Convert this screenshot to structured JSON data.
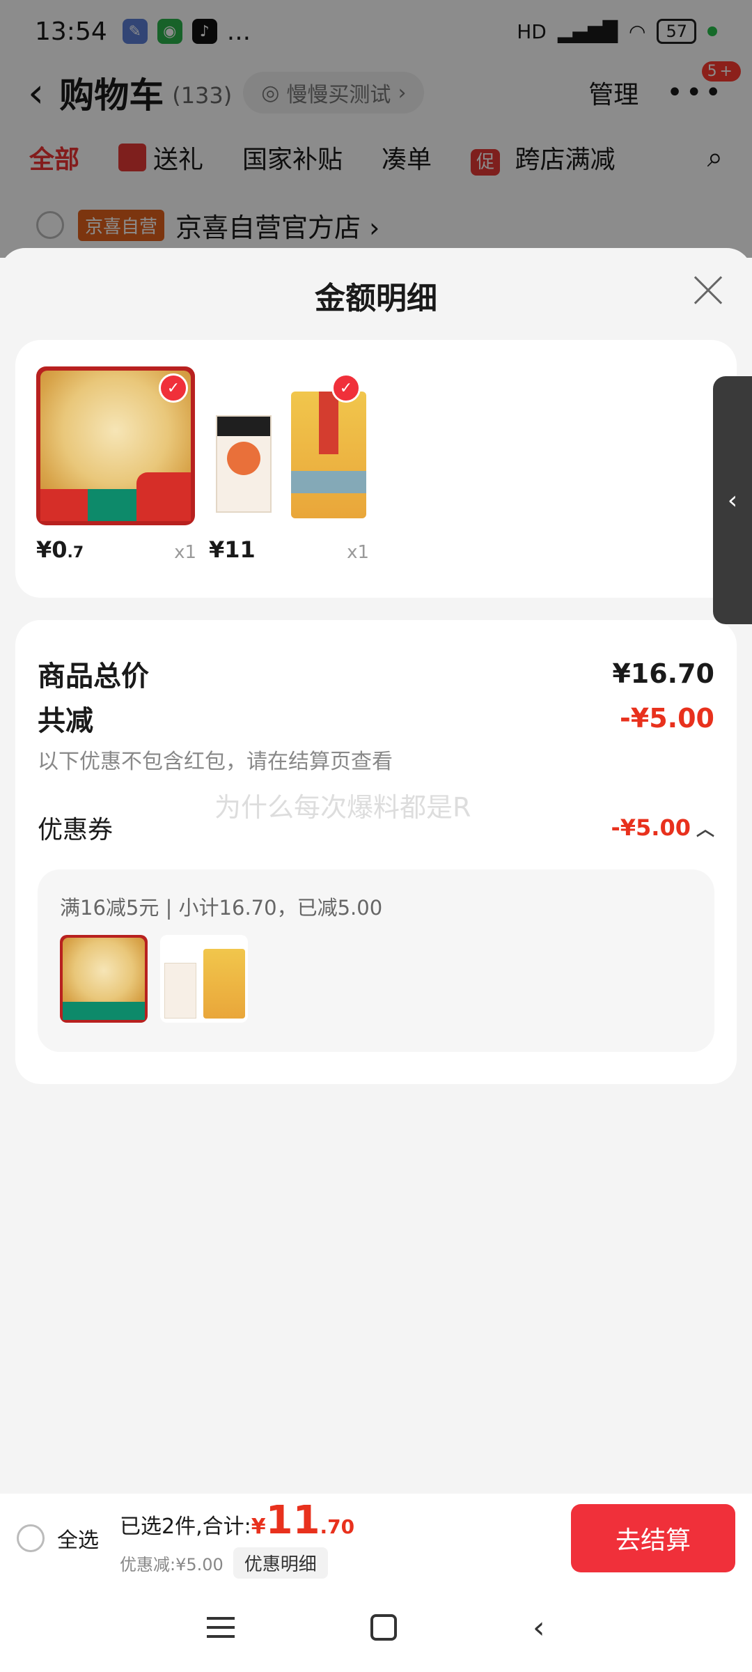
{
  "status_bar": {
    "time": "13:54",
    "network": "HD",
    "battery": "57",
    "more": "..."
  },
  "nav": {
    "back_icon": "chevron-left-icon",
    "title": "购物车",
    "count": "(133)",
    "pill_label": "慢慢买测试",
    "manage": "管理",
    "more": "•••",
    "badge": "5+"
  },
  "tabs": [
    {
      "label": "全部"
    },
    {
      "label": "送礼"
    },
    {
      "label": "国家补贴"
    },
    {
      "label": "凑单"
    },
    {
      "label": "跨店满减",
      "tag": "促"
    }
  ],
  "store": {
    "tag": "京喜自营",
    "name": "京喜自营官方店 ›"
  },
  "sheet": {
    "title": "金额明细",
    "products": [
      {
        "price_main": "¥0",
        "price_decimal": ".7",
        "qty": "x1"
      },
      {
        "price_main": "¥11",
        "price_decimal": "",
        "qty": "x1"
      }
    ],
    "summary": {
      "total_label": "商品总价",
      "total_value": "¥16.70",
      "reduce_label": "共减",
      "reduce_value": "-¥5.00",
      "note": "以下优惠不包含红包，请在结算页查看",
      "coupon_label": "优惠券",
      "coupon_value": "-¥5.00",
      "coupon_detail": "满16减5元 | 小计16.70，已减5.00"
    },
    "watermark": "为什么每次爆料都是R"
  },
  "bottom": {
    "select_all": "全选",
    "selected_prefix": "已选2件,合计:",
    "currency": "¥",
    "amount_int": "11",
    "amount_dec": ".70",
    "discount": "优惠减:¥5.00",
    "detail_button": "优惠明细",
    "checkout": "去结算"
  },
  "colors": {
    "accent_red": "#f0303a",
    "price_red": "#e8311d",
    "store_tag": "#e2621c"
  }
}
